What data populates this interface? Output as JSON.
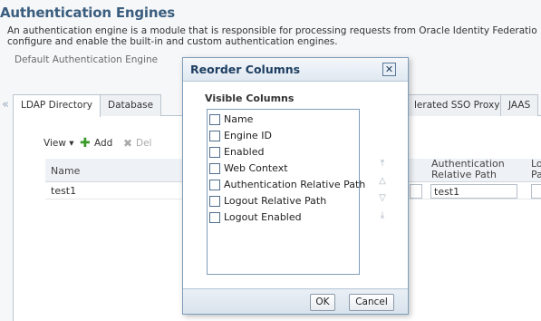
{
  "page": {
    "title": "Authentication Engines",
    "description_line1": "An authentication engine is a module that is responsible for processing requests from Oracle Identity Federatio",
    "description_line2": "configure and enable the built-in and custom authentication engines.",
    "default_engine_label": "Default Authentication Engine"
  },
  "tabs": [
    {
      "label": "LDAP Directory"
    },
    {
      "label": "Database"
    },
    {
      "label": "lerated SSO Proxy"
    },
    {
      "label": "JAAS"
    }
  ],
  "toolbar": {
    "view_label": "View ▾",
    "add_label": "Add",
    "delete_label": "Del"
  },
  "grid": {
    "headers": {
      "name": "Name",
      "auth_relative_path": "Authentication Relative Path",
      "logout_partial": "Lo Pa"
    },
    "rows": [
      {
        "name": "test1",
        "auth_relative_path": "test1"
      }
    ]
  },
  "dialog": {
    "title": "Reorder Columns",
    "close_glyph": "✕",
    "subtitle": "Visible Columns",
    "columns": [
      {
        "label": "Name",
        "checked": false
      },
      {
        "label": "Engine ID",
        "checked": false
      },
      {
        "label": "Enabled",
        "checked": false
      },
      {
        "label": "Web Context",
        "checked": false
      },
      {
        "label": "Authentication Relative Path",
        "checked": false
      },
      {
        "label": "Logout Relative Path",
        "checked": false
      },
      {
        "label": "Logout Enabled",
        "checked": false
      }
    ],
    "reorder_icons": {
      "move_top": "⤒",
      "move_up": "△",
      "move_down": "▽",
      "move_bottom": "⤓"
    },
    "ok_label": "OK",
    "cancel_label": "Cancel"
  },
  "colors": {
    "title": "#3b5e7f",
    "dialog_title": "#1e3f62",
    "add_icon": "#3a9a2a",
    "border": "#7f9db9"
  }
}
